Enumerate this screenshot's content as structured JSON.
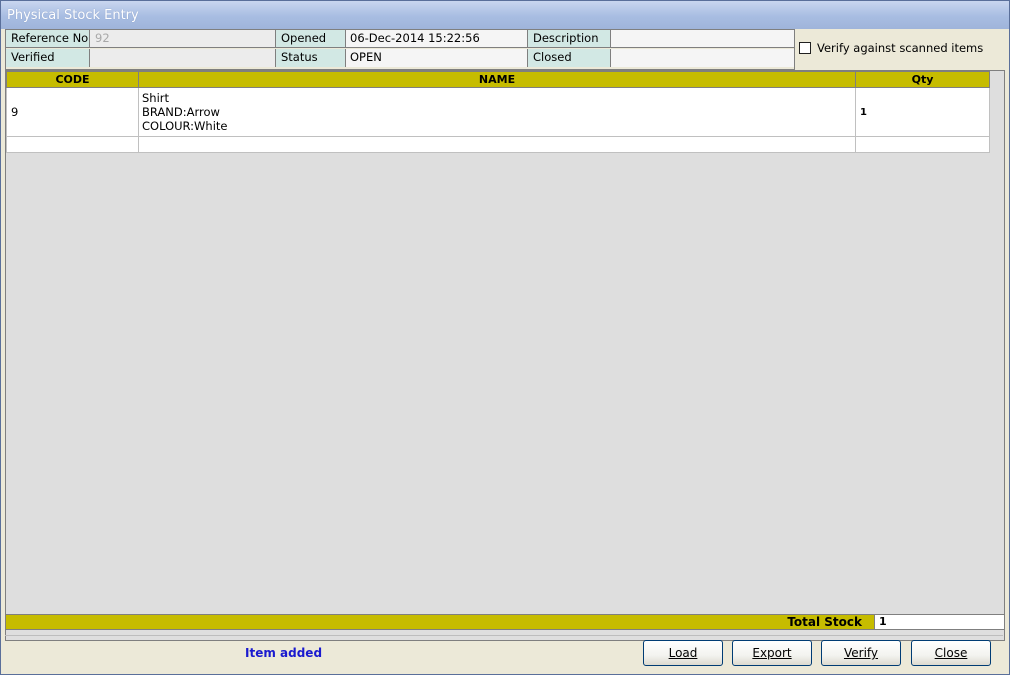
{
  "window": {
    "title": "Physical Stock Entry"
  },
  "info": {
    "reference_label": "Reference No",
    "reference_value": "92",
    "opened_label": "Opened",
    "opened_value": "06-Dec-2014 15:22:56",
    "description_label": "Description",
    "description_value": "",
    "verified_label": "Verified",
    "verified_value": "",
    "status_label": "Status",
    "status_value": "OPEN",
    "closed_label": "Closed",
    "closed_value": ""
  },
  "verify_scanned": {
    "label": "Verify against scanned items",
    "checked": false
  },
  "grid": {
    "headers": [
      "CODE",
      "NAME",
      "Qty"
    ],
    "rows": [
      {
        "code": "9",
        "name_lines": [
          "Shirt",
          "BRAND:Arrow",
          "COLOUR:White"
        ],
        "qty": "1"
      }
    ]
  },
  "total": {
    "label": "Total Stock",
    "value": "1"
  },
  "status": {
    "message": "Item added"
  },
  "buttons": {
    "load": "Load",
    "export": "Export",
    "verify": "Verify",
    "close": "Close"
  },
  "colors": {
    "header_bg": "#c6bc00",
    "label_bg": "#d2e8e4",
    "status_text": "#1a1acf"
  }
}
